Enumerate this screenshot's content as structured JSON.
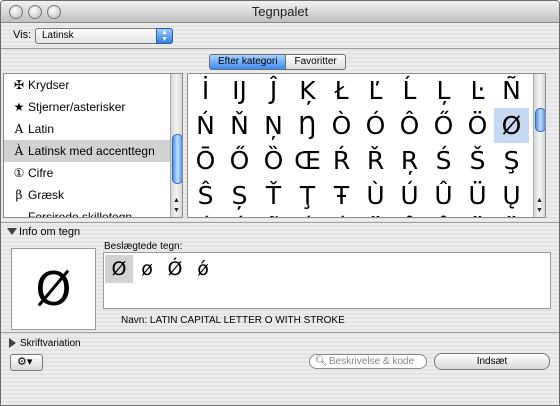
{
  "window": {
    "title": "Tegnpalet"
  },
  "vis": {
    "label": "Vis:",
    "value": "Latinsk"
  },
  "tabs": [
    {
      "label": "Efter kategori",
      "active": true
    },
    {
      "label": "Favoritter",
      "active": false
    }
  ],
  "categories": [
    {
      "icon": "✠",
      "label": "Krydser"
    },
    {
      "icon": "★",
      "label": "Stjerner/asterisker"
    },
    {
      "icon": "A",
      "label": "Latin"
    },
    {
      "icon": "À",
      "label": "Latinsk med accenttegn",
      "selected": true
    },
    {
      "icon": "①",
      "label": "Cifre"
    },
    {
      "icon": "β",
      "label": "Græsk"
    },
    {
      "icon": "—",
      "label": "Forsirede skilletegn"
    }
  ],
  "grid": {
    "rows": [
      [
        "İ",
        "Ĳ",
        "Ĵ",
        "Ķ",
        "Ł",
        "Ľ",
        "Ĺ",
        "Ļ",
        "Ŀ",
        "Ñ"
      ],
      [
        "Ń",
        "Ň",
        "Ņ",
        "Ŋ",
        "Ò",
        "Ó",
        "Ô",
        "Ő",
        "Ö",
        "Ø"
      ],
      [
        "Ō",
        "Ő",
        "Ȍ",
        "Œ",
        "Ŕ",
        "Ř",
        "Ŗ",
        "Ś",
        "Š",
        "Ş"
      ],
      [
        "Ŝ",
        "Ș",
        "Ť",
        "Ţ",
        "Ŧ",
        "Ù",
        "Ú",
        "Û",
        "Ü",
        "Ų"
      ],
      [
        "Ú",
        "Ú",
        "Ũ",
        "Ú",
        "Ú",
        "Ü",
        "Ů",
        "Ů",
        "Ü",
        "Ü"
      ]
    ],
    "selected": "Ø"
  },
  "info": {
    "header": "Info om tegn",
    "preview_char": "Ø",
    "related_label": "Beslægtede tegn:",
    "related": [
      "Ø",
      "ø",
      "Ǿ",
      "ǿ"
    ],
    "name": "Navn:  LATIN CAPITAL LETTER O WITH STROKE"
  },
  "font_variation": {
    "label": "Skriftvariation"
  },
  "bottom": {
    "gear_glyph": "⚙▾",
    "search_icon": "magnifier-icon",
    "search_placeholder": "Beskrivelse & kode",
    "insert_label": "Indsæt"
  },
  "colors": {
    "selection_blue": "#c7d9f2",
    "tab_active": "#3d8cf0"
  }
}
